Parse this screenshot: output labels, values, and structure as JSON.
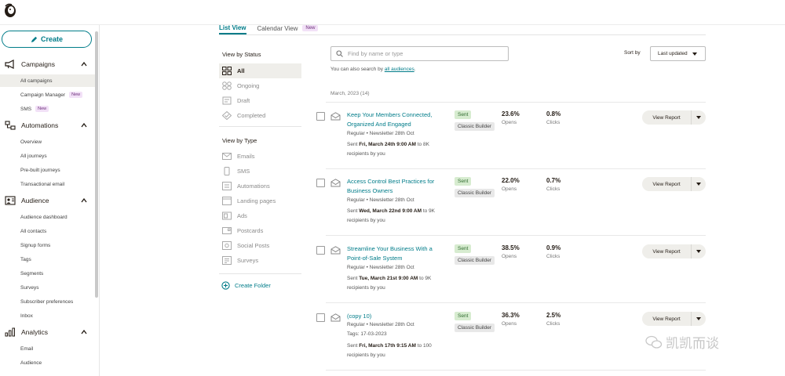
{
  "sidebar": {
    "create_label": "Create",
    "sections": [
      {
        "label": "Campaigns",
        "icon": "megaphone-icon",
        "items": [
          {
            "label": "All campaigns"
          },
          {
            "label": "Campaign Manager",
            "badge": "New"
          },
          {
            "label": "SMS",
            "badge": "New"
          }
        ]
      },
      {
        "label": "Automations",
        "icon": "automations-icon",
        "items": [
          {
            "label": "Overview"
          },
          {
            "label": "All journeys"
          },
          {
            "label": "Pre-built journeys"
          },
          {
            "label": "Transactional email"
          }
        ]
      },
      {
        "label": "Audience",
        "icon": "audience-icon",
        "items": [
          {
            "label": "Audience dashboard"
          },
          {
            "label": "All contacts"
          },
          {
            "label": "Signup forms"
          },
          {
            "label": "Tags"
          },
          {
            "label": "Segments"
          },
          {
            "label": "Surveys"
          },
          {
            "label": "Subscriber preferences"
          },
          {
            "label": "Inbox"
          }
        ]
      },
      {
        "label": "Analytics",
        "icon": "analytics-icon",
        "items": [
          {
            "label": "Email"
          },
          {
            "label": "Audience"
          }
        ]
      }
    ]
  },
  "tabs": {
    "list_view": "List View",
    "calendar_view": "Calendar View",
    "new_badge": "New"
  },
  "filters": {
    "status_heading": "View by Status",
    "status": [
      "All",
      "Ongoing",
      "Draft",
      "Completed"
    ],
    "type_heading": "View by Type",
    "type": [
      "Emails",
      "SMS",
      "Automations",
      "Landing pages",
      "Ads",
      "Postcards",
      "Social Posts",
      "Surveys"
    ],
    "create_folder": "Create Folder"
  },
  "search": {
    "placeholder": "Find by name or type",
    "hint_prefix": "You can also search by ",
    "hint_link": "all audiences",
    "hint_suffix": "."
  },
  "sort": {
    "label": "Sort by",
    "value": "Last updated"
  },
  "group_label": "March, 2023 (14)",
  "campaigns": [
    {
      "title": "Keep Your Members Connected, Organized And Engaged",
      "type": "Regular • Newsletter 28th Oct",
      "sent_prefix": "Sent ",
      "sent_date": "Fri, March 24th 9:00 AM",
      "sent_suffix": " to 8K",
      "recipients": "recipients by you",
      "status": "Sent",
      "builder": "Classic Builder",
      "opens": "23.6%",
      "opens_label": "Opens",
      "clicks": "0.8%",
      "clicks_label": "Clicks",
      "action": "View Report"
    },
    {
      "title": "Access Control Best Practices for Business Owners",
      "type": "Regular • Newsletter 28th Oct",
      "sent_prefix": "Sent ",
      "sent_date": "Wed, March 22nd 9:00 AM",
      "sent_suffix": " to 9K",
      "recipients": "recipients by you",
      "status": "Sent",
      "builder": "Classic Builder",
      "opens": "22.0%",
      "opens_label": "Opens",
      "clicks": "0.7%",
      "clicks_label": "Clicks",
      "action": "View Report"
    },
    {
      "title": "Streamline Your Business With a Point-of-Sale System",
      "type": "Regular • Newsletter 28th Oct",
      "sent_prefix": "Sent ",
      "sent_date": "Tue, March 21st 9:00 AM",
      "sent_suffix": " to 9K",
      "recipients": "recipients by you",
      "status": "Sent",
      "builder": "Classic Builder",
      "opens": "38.5%",
      "opens_label": "Opens",
      "clicks": "0.9%",
      "clicks_label": "Clicks",
      "action": "View Report"
    },
    {
      "title": "(copy 10)",
      "type": "Regular • Newsletter 28th Oct",
      "tags": "Tags: 17-03-2023",
      "sent_prefix": "Sent ",
      "sent_date": "Fri, March 17th 9:15 AM",
      "sent_suffix": " to 100",
      "recipients": "recipients by you",
      "status": "Sent",
      "builder": "Classic Builder",
      "opens": "36.3%",
      "opens_label": "Opens",
      "clicks": "2.5%",
      "clicks_label": "Clicks",
      "action": "View Report"
    }
  ],
  "watermark": "凯凯而谈",
  "colors": {
    "accent": "#007c89",
    "sent_tag": "#d7ecd0",
    "new_badge": "#f2e1f7",
    "active_bg": "#efeeea"
  }
}
